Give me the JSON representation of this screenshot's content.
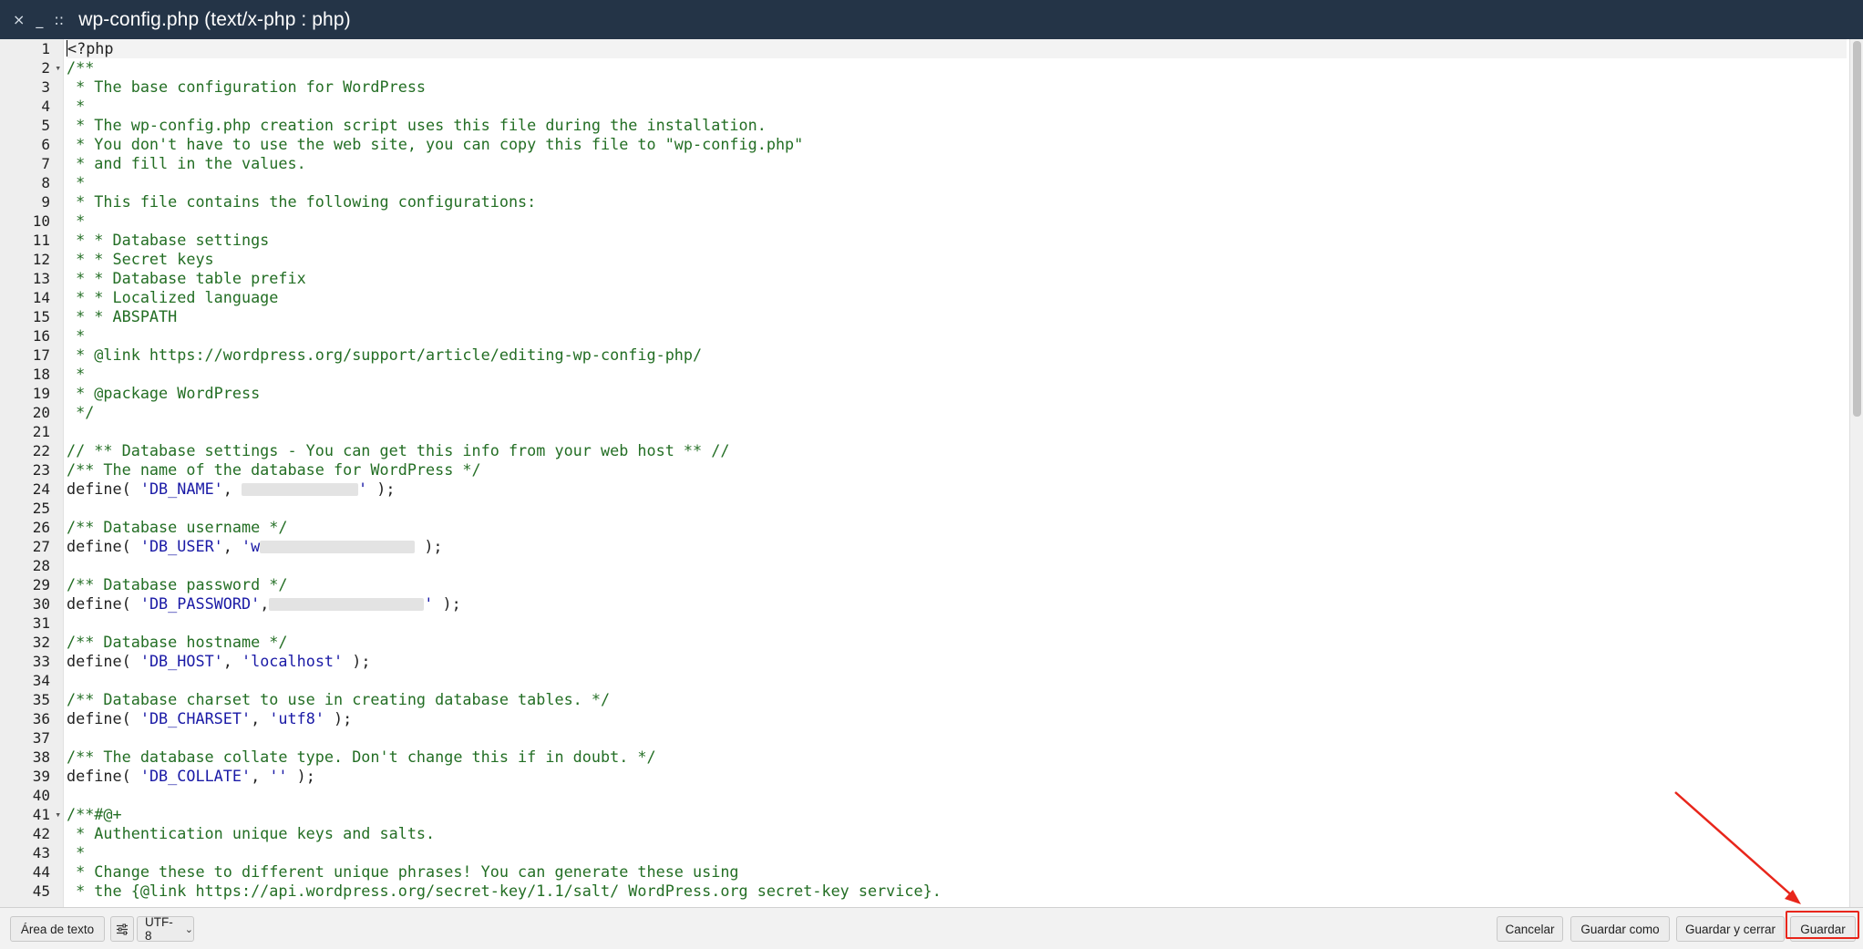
{
  "window": {
    "title": "wp-config.php (text/x-php : php)",
    "controls": {
      "close": "×",
      "minimize": "_",
      "drag": "::"
    }
  },
  "editor": {
    "line_numbers": [
      "1",
      "2",
      "3",
      "4",
      "5",
      "6",
      "7",
      "8",
      "9",
      "10",
      "11",
      "12",
      "13",
      "14",
      "15",
      "16",
      "17",
      "18",
      "19",
      "20",
      "21",
      "22",
      "23",
      "24",
      "25",
      "26",
      "27",
      "28",
      "29",
      "30",
      "31",
      "32",
      "33",
      "34",
      "35",
      "36",
      "37",
      "38",
      "39",
      "40",
      "41",
      "42",
      "43",
      "44",
      "45"
    ],
    "fold_lines": [
      2,
      41
    ],
    "lines": {
      "l1": "<?php",
      "l2": "/**",
      "l3": " * The base configuration for WordPress",
      "l4": " *",
      "l5": " * The wp-config.php creation script uses this file during the installation.",
      "l6": " * You don't have to use the web site, you can copy this file to \"wp-config.php\"",
      "l7": " * and fill in the values.",
      "l8": " *",
      "l9": " * This file contains the following configurations:",
      "l10": " *",
      "l11": " * * Database settings",
      "l12": " * * Secret keys",
      "l13": " * * Database table prefix",
      "l14": " * * Localized language",
      "l15": " * * ABSPATH",
      "l16": " *",
      "l17": " * @link https://wordpress.org/support/article/editing-wp-config-php/",
      "l18": " *",
      "l19": " * @package WordPress",
      "l20": " */",
      "l22": "// ** Database settings - You can get this info from your web host ** //",
      "l23": "/** The name of the database for WordPress */",
      "l26": "/** Database username */",
      "l29": "/** Database password */",
      "l32": "/** Database hostname */",
      "l35": "/** Database charset to use in creating database tables. */",
      "l38": "/** The database collate type. Don't change this if in doubt. */",
      "l41": "/**#@+",
      "l42": " * Authentication unique keys and salts.",
      "l43": " *",
      "l44": " * Change these to different unique phrases! You can generate these using",
      "l45": " * the {@link https://api.wordpress.org/secret-key/1.1/salt/ WordPress.org secret-key service}."
    },
    "tokens": {
      "define": "define(",
      "close": " );",
      "comma": ",",
      "db_name": "'DB_NAME'",
      "db_user": "'DB_USER'",
      "db_password": "'DB_PASSWORD'",
      "db_host": "'DB_HOST'",
      "localhost": "'localhost'",
      "db_charset": "'DB_CHARSET'",
      "utf8": "'utf8'",
      "db_collate": "'DB_COLLATE'",
      "empty": "''",
      "quote": "'",
      "quote_w": "'w"
    }
  },
  "footer": {
    "textarea_label": "Área de texto",
    "settings_icon": "sliders-icon",
    "encoding": "UTF-8",
    "cancel_label": "Cancelar",
    "save_as_label": "Guardar como",
    "save_close_label": "Guardar y cerrar",
    "save_label": "Guardar"
  },
  "colors": {
    "titlebar": "#243447",
    "comment": "#236e24",
    "string": "#1a1aa6",
    "annotation": "#e8261b"
  }
}
